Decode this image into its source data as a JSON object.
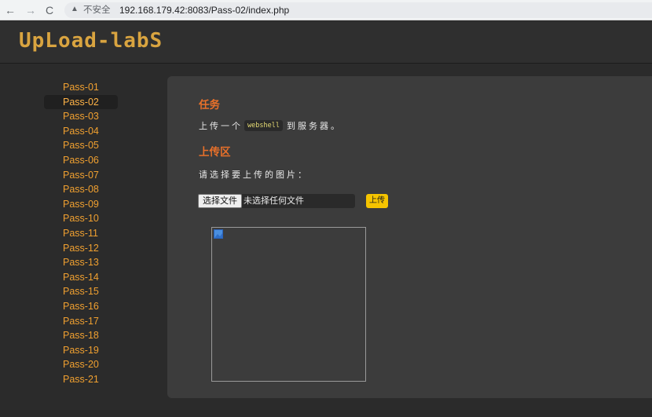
{
  "browser": {
    "insecure_label": "不安全",
    "url": "192.168.179.42:8083/Pass-02/index.php",
    "back_icon": "←",
    "forward_icon": "→",
    "reload_icon": "C",
    "warning_icon": "▲"
  },
  "site": {
    "logo_text": "UpLoad-labS"
  },
  "sidebar": {
    "items": [
      {
        "label": "Pass-01"
      },
      {
        "label": "Pass-02"
      },
      {
        "label": "Pass-03"
      },
      {
        "label": "Pass-04"
      },
      {
        "label": "Pass-05"
      },
      {
        "label": "Pass-06"
      },
      {
        "label": "Pass-07"
      },
      {
        "label": "Pass-08"
      },
      {
        "label": "Pass-09"
      },
      {
        "label": "Pass-10"
      },
      {
        "label": "Pass-11"
      },
      {
        "label": "Pass-12"
      },
      {
        "label": "Pass-13"
      },
      {
        "label": "Pass-14"
      },
      {
        "label": "Pass-15"
      },
      {
        "label": "Pass-16"
      },
      {
        "label": "Pass-17"
      },
      {
        "label": "Pass-18"
      },
      {
        "label": "Pass-19"
      },
      {
        "label": "Pass-20"
      },
      {
        "label": "Pass-21"
      }
    ],
    "active_index": 1
  },
  "main": {
    "task_heading": "任务",
    "task_prefix": "上传一个",
    "task_code": "webshell",
    "task_suffix": "到服务器。",
    "upload_heading": "上传区",
    "choose_prompt": "请选择要上传的图片：",
    "file_button": "选择文件",
    "file_status": "未选择任何文件",
    "upload_button": "上传"
  },
  "colors": {
    "accent_orange": "#e8702a",
    "link_orange": "#f0a030",
    "logo_gold": "#d9a440",
    "button_yellow": "#f5c400"
  }
}
